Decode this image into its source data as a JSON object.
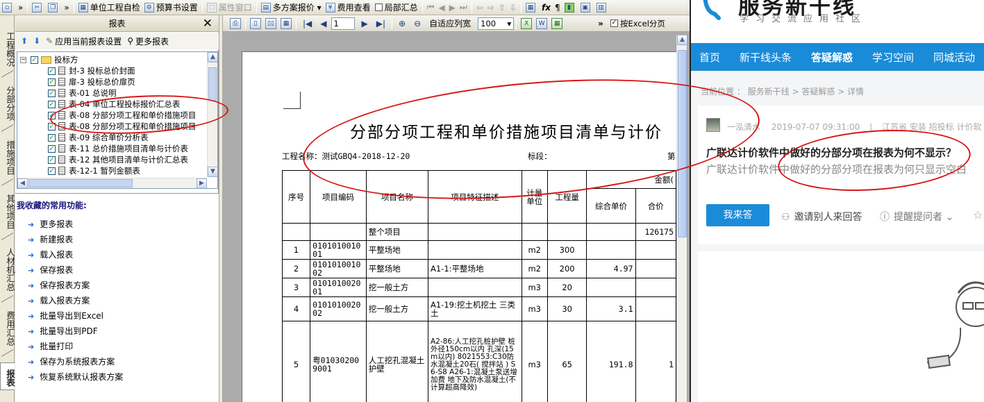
{
  "toolbar": {
    "items": [
      "单位工程自检",
      "预算书设置",
      "属性窗口",
      "多方案报价",
      "费用查看",
      "局部汇总"
    ]
  },
  "vtabs": [
    "工程概况",
    "分部分项",
    "措施项目",
    "其他项目",
    "人材机汇总",
    "费用汇总",
    "报表"
  ],
  "panel": {
    "title": "报表",
    "close": "✕",
    "apply_label": "应用当前报表设置",
    "more_label": "更多报表",
    "tree_root": "投标方",
    "tree_items": [
      "封-3 投标总价封面",
      "扉-3 投标总价扉页",
      "表-01 总说明",
      "表-04 单位工程投标报价汇总表",
      "表-08 分部分项工程和单价措施项目",
      "表-08 分部分项工程和单价措施项目",
      "表-09 综合单价分析表",
      "表-11 总价措施项目清单与计价表",
      "表-12 其他项目清单与计价汇总表",
      "表-12-1 暂列金额表"
    ],
    "fav_title": "我收藏的常用功能:",
    "fav_items": [
      "更多报表",
      "新建报表",
      "载入报表",
      "保存报表",
      "保存报表方案",
      "载入报表方案",
      "批量导出到Excel",
      "批量导出到PDF",
      "批量打印",
      "保存为系统报表方案",
      "恢复系统默认报表方案"
    ]
  },
  "viewer": {
    "page_value": "1",
    "fit_label": "自适应列宽",
    "zoom_value": "100",
    "excel_label": "按Excel分页"
  },
  "report": {
    "title": "分部分项工程和单价措施项目清单与计价",
    "project_label": "工程名称：测试GBQ4-2018-12-20",
    "section_label": "标段：",
    "page_label": "第",
    "headers": {
      "seq": "序号",
      "code": "项目编码",
      "name": "项目名称",
      "desc": "项目特征描述",
      "unit": "计量单位",
      "qty": "工程量",
      "amount": "金额(",
      "unit_price": "综合单价",
      "total": "合价"
    },
    "rows": [
      {
        "seq": "",
        "code": "",
        "name": "整个项目",
        "desc": "",
        "unit": "",
        "qty": "",
        "price": "",
        "total": "126175"
      },
      {
        "seq": "1",
        "code": "010101001001",
        "name": "平整场地",
        "desc": "",
        "unit": "m2",
        "qty": "300",
        "price": "",
        "total": ""
      },
      {
        "seq": "2",
        "code": "010101001002",
        "name": "平整场地",
        "desc": "A1-1:平整场地",
        "unit": "m2",
        "qty": "200",
        "price": "4.97",
        "total": ""
      },
      {
        "seq": "3",
        "code": "010101002001",
        "name": "挖一般土方",
        "desc": "",
        "unit": "m3",
        "qty": "20",
        "price": "",
        "total": ""
      },
      {
        "seq": "4",
        "code": "010101002002",
        "name": "挖一般土方",
        "desc": "A1-19:挖土机挖土 三类土",
        "unit": "m3",
        "qty": "30",
        "price": "3.1",
        "total": ""
      },
      {
        "seq": "5",
        "code": "粤010302009001",
        "name": "人工挖孔混凝土护壁",
        "desc": "A2-86:人工挖孔桩护壁 桩外径150cm以内 孔深(15m以内) 8021553:C30防水混凝土20石( 搅拌站 ) S6-S8 A26-1:混凝土泵送增加费 地下及防水混凝土(不计算超高降效)",
        "unit": "m3",
        "qty": "65",
        "price": "191.8",
        "total": "1"
      }
    ]
  },
  "site": {
    "logo_text": "服务新干线",
    "logo_sub": "学习交流应用社区",
    "nav": [
      "首页",
      "新干线头条",
      "答疑解惑",
      "学习空间",
      "同城活动"
    ],
    "crumb": "当前位置 ： 服务新干线 > 答疑解惑 > 详情",
    "author": "一泓清水",
    "date": "2019-07-07 09:31:00",
    "tags": "江苏省  安装  招投标  计价软",
    "question_title": "广联达计价软件中做好的分部分项在报表为何不显示？",
    "question_desc": "广联达计价软件中做好的分部分项在报表为何只显示空白",
    "answer_btn": "我来答",
    "invite": "邀请别人来回答",
    "remind": "提醒提问者"
  },
  "colors": {
    "brand_blue": "#1a8bd8",
    "annotation_red": "#d81414"
  }
}
